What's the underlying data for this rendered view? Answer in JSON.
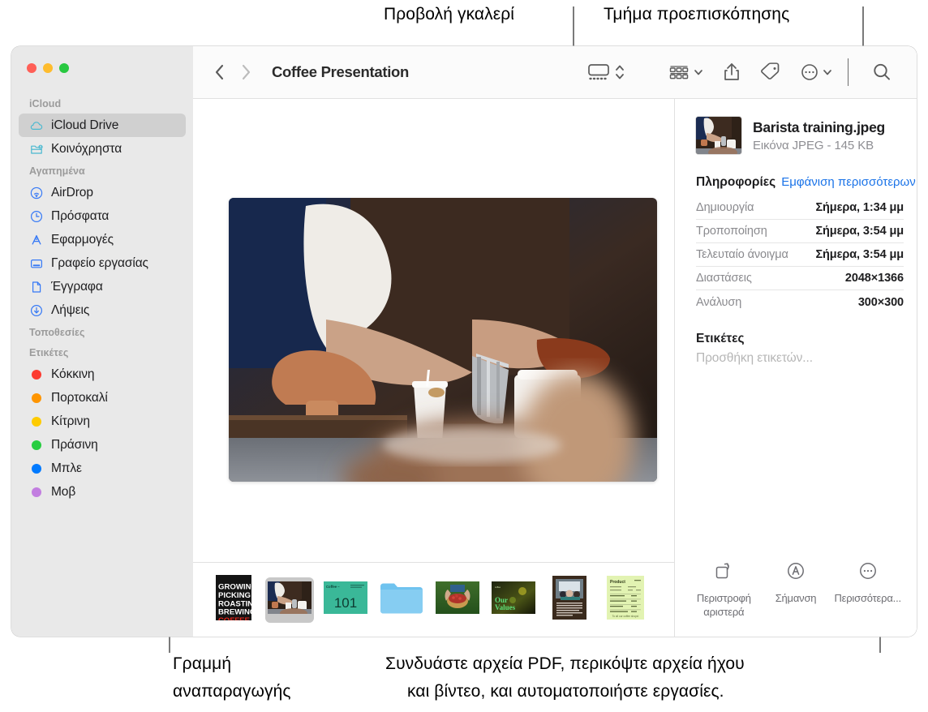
{
  "callouts": {
    "gallery_view": "Προβολή γκαλερί",
    "preview_pane": "Τμήμα προεπισκόπησης",
    "playback_bar_line1": "Γραμμή",
    "playback_bar_line2": "αναπαραγωγής",
    "quick_actions_line1": "Συνδυάστε αρχεία PDF, περικόψτε αρχεία ήχου",
    "quick_actions_line2": "και βίντεο, και αυτοματοποιήστε εργασίες."
  },
  "window": {
    "traffic_lights": [
      {
        "name": "close",
        "color": "#ff5f57"
      },
      {
        "name": "minimize",
        "color": "#febc2e"
      },
      {
        "name": "zoom",
        "color": "#28c840"
      }
    ]
  },
  "toolbar": {
    "back_icon": "chevron-left-icon",
    "forward_icon": "chevron-right-icon",
    "title": "Coffee Presentation",
    "view_gallery_icon": "gallery-view-icon",
    "view_stepper_icon": "chevron-up-down-icon",
    "group_icon": "group-items-icon",
    "group_chevron_icon": "chevron-down-icon",
    "share_icon": "share-icon",
    "tag_icon": "tag-icon",
    "more_icon": "ellipsis-circle-icon",
    "more_chevron_icon": "chevron-down-icon",
    "search_icon": "search-icon"
  },
  "sidebar": {
    "groups": [
      {
        "title": "iCloud",
        "items": [
          {
            "label": "iCloud Drive",
            "icon": "cloud-icon",
            "color": "#4ab9d0",
            "selected": true
          },
          {
            "label": "Κοινόχρηστα",
            "icon": "shared-folder-icon",
            "color": "#4ab9d0",
            "selected": false
          }
        ]
      },
      {
        "title": "Αγαπημένα",
        "items": [
          {
            "label": "AirDrop",
            "icon": "airdrop-icon",
            "color": "#3478f6",
            "selected": false
          },
          {
            "label": "Πρόσφατα",
            "icon": "clock-icon",
            "color": "#3478f6",
            "selected": false
          },
          {
            "label": "Εφαρμογές",
            "icon": "applications-icon",
            "color": "#3478f6",
            "selected": false
          },
          {
            "label": "Γραφείο εργασίας",
            "icon": "desktop-icon",
            "color": "#3478f6",
            "selected": false
          },
          {
            "label": "Έγγραφα",
            "icon": "documents-icon",
            "color": "#3478f6",
            "selected": false
          },
          {
            "label": "Λήψεις",
            "icon": "downloads-icon",
            "color": "#3478f6",
            "selected": false
          }
        ]
      },
      {
        "title": "Τοποθεσίες",
        "items": []
      },
      {
        "title": "Ετικέτες",
        "items": [
          {
            "label": "Κόκκινη",
            "icon": "tag-dot-icon",
            "color": "#fc3b30",
            "selected": false
          },
          {
            "label": "Πορτοκαλί",
            "icon": "tag-dot-icon",
            "color": "#fe9500",
            "selected": false
          },
          {
            "label": "Κίτρινη",
            "icon": "tag-dot-icon",
            "color": "#fecb00",
            "selected": false
          },
          {
            "label": "Πράσινη",
            "icon": "tag-dot-icon",
            "color": "#28cd41",
            "selected": false
          },
          {
            "label": "Μπλε",
            "icon": "tag-dot-icon",
            "color": "#007aff",
            "selected": false
          },
          {
            "label": "Μοβ",
            "icon": "tag-dot-icon",
            "color": "#c27ee0",
            "selected": false
          }
        ]
      }
    ]
  },
  "preview": {
    "image_alt": "barista-pouring-milk-photo",
    "filmstrip": [
      {
        "name": "coffee-poster-thumbnail",
        "kind": "poster",
        "selected": false,
        "lines": [
          "GROWING",
          "PICKING",
          "ROASTING",
          "BREWING",
          "COFFEE"
        ]
      },
      {
        "name": "barista-training-thumbnail",
        "kind": "photo",
        "selected": true
      },
      {
        "name": "coffee-101-slide-thumbnail",
        "kind": "slide",
        "selected": false,
        "title": "Coffee –",
        "big": "101"
      },
      {
        "name": "folder-thumbnail",
        "kind": "folder",
        "selected": false
      },
      {
        "name": "berries-basket-thumbnail",
        "kind": "photo",
        "selected": false
      },
      {
        "name": "our-values-thumbnail",
        "kind": "poster",
        "selected": false,
        "lines": [
          "Our",
          "Values"
        ]
      },
      {
        "name": "meeting-document-thumbnail",
        "kind": "document",
        "selected": false
      },
      {
        "name": "spreadsheet-thumbnail",
        "kind": "spreadsheet",
        "selected": false
      }
    ]
  },
  "info": {
    "file_name": "Barista training.jpeg",
    "file_kind": "Εικόνα JPEG - 145 KB",
    "thumbnail": "barista-training-thumbnail",
    "general_title": "Πληροφορίες",
    "show_more": "Εμφάνιση περισσότερων",
    "rows": [
      {
        "key": "Δημιουργία",
        "value": "Σήμερα, 1:34 μμ"
      },
      {
        "key": "Τροποποίηση",
        "value": "Σήμερα, 3:54 μμ"
      },
      {
        "key": "Τελευταίο άνοιγμα",
        "value": "Σήμερα, 3:54 μμ"
      },
      {
        "key": "Διαστάσεις",
        "value": "2048×1366"
      },
      {
        "key": "Ανάλυση",
        "value": "300×300"
      }
    ],
    "tags_title": "Ετικέτες",
    "tags_placeholder": "Προσθήκη ετικετών...",
    "quick_actions": [
      {
        "label": "Περιστροφή αριστερά",
        "icon": "rotate-left-icon"
      },
      {
        "label": "Σήμανση",
        "icon": "markup-icon"
      },
      {
        "label": "Περισσότερα...",
        "icon": "ellipsis-circle-icon"
      }
    ]
  }
}
